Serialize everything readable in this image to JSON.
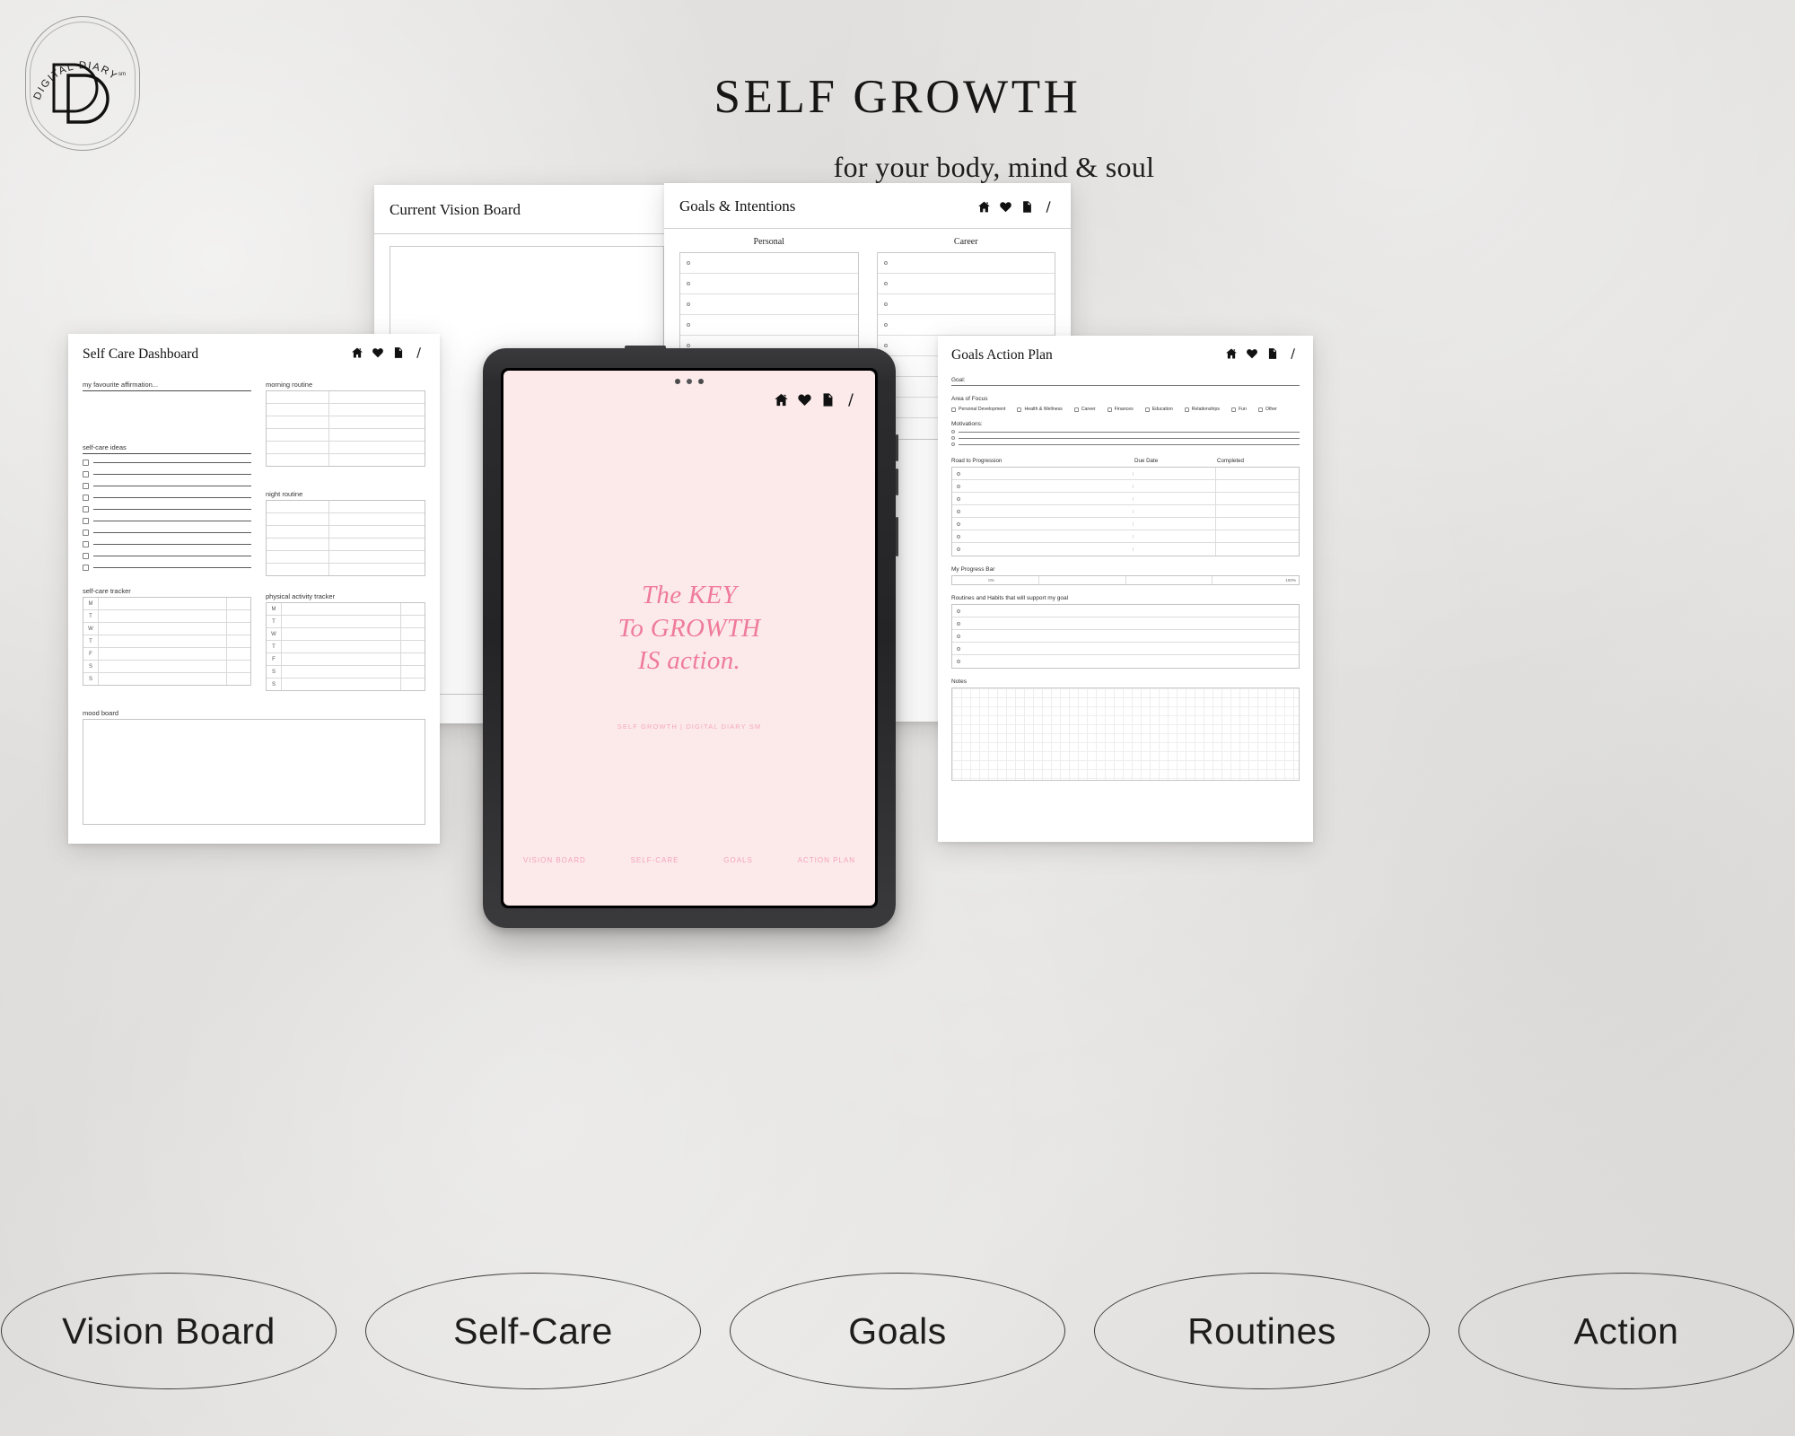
{
  "brand": {
    "logo_arc_text": "DIGITAL DIARY",
    "logo_tm": "sm",
    "logo_monogram": "DD"
  },
  "header": {
    "title": "SELF GROWTH",
    "subtitle": "for your body, mind & soul"
  },
  "colors": {
    "background": "#e2e1df",
    "tablet_screen": "#fceaea",
    "accent_pink": "#ef7b9a",
    "nav_pink": "#f4a3bb",
    "ink": "#161616"
  },
  "icons": [
    "home-icon",
    "heart-icon",
    "document-icon",
    "pen-slash-icon"
  ],
  "sheets": {
    "vision_board": {
      "title": "Current Vision Board"
    },
    "goals_intentions": {
      "title": "Goals & Intentions",
      "columns": [
        {
          "heading": "Personal",
          "rows": 9
        },
        {
          "heading": "Career",
          "rows": 9
        }
      ]
    },
    "self_care": {
      "title": "Self Care Dashboard",
      "affirmation_label": "my favourite affirmation...",
      "ideas_label": "self-care ideas",
      "ideas_count": 10,
      "morning_routine_label": "morning routine",
      "night_routine_label": "night routine",
      "self_care_tracker_label": "self-care tracker",
      "physical_tracker_label": "physical activity tracker",
      "days": [
        "M",
        "T",
        "W",
        "T",
        "F",
        "S",
        "S"
      ],
      "mood_board_label": "mood board"
    },
    "action_plan": {
      "title": "Goals Action Plan",
      "goal_label": "Goal:",
      "area_of_focus_label": "Area of Focus",
      "focus_options": [
        "Personal Development",
        "Health & Wellness",
        "Career",
        "Finances",
        "Education",
        "Relationships",
        "Fun",
        "Other"
      ],
      "motivations_label": "Motivations:",
      "motivations_count": 3,
      "road_label": "Road to Progression",
      "due_date_label": "Due Date",
      "completed_label": "Completed",
      "road_rows": 7,
      "progress_label": "My Progress Bar",
      "progress_min": "0%",
      "progress_max": "100%",
      "routines_label": "Routines and Habits that will support my goal",
      "routines_rows": 5,
      "notes_label": "Notes"
    }
  },
  "tablet": {
    "quote_lines": [
      "The KEY",
      "To GROWTH",
      "IS action."
    ],
    "tagline": "SELF GROWTH | DIGITAL DIARY SM",
    "nav": [
      "VISION BOARD",
      "SELF-CARE",
      "GOALS",
      "ACTION PLAN"
    ]
  },
  "ovals": [
    "Vision Board",
    "Self-Care",
    "Goals",
    "Routines",
    "Action"
  ]
}
